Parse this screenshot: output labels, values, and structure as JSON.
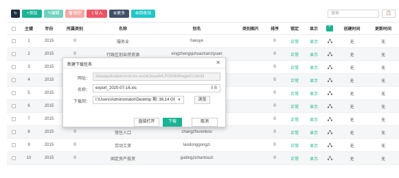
{
  "toolbar": {
    "refresh_icon": "↻",
    "add_label": "+添加",
    "edit_label": "✎编辑",
    "delete_label": "🗑删除",
    "import_label": "⇪导入",
    "more_label": "⚙更多",
    "recycle_label": "♻回收站",
    "search_placeholder": "搜索",
    "search_button_label": "📋"
  },
  "table": {
    "headers": {
      "id": "主键",
      "year": "年份",
      "category": "所属类别",
      "name": "名称",
      "alias": "别名",
      "image": "类别图片",
      "sort": "排序",
      "lock": "锁定",
      "show": "显示",
      "created": "创建时间",
      "updated": "更新时间"
    },
    "rows": [
      {
        "id": "1",
        "year": "2015",
        "category": "0",
        "name": "服务业",
        "alias": "fuwuye",
        "sort": "0",
        "lock": "正常",
        "show": "显示",
        "created": "无",
        "updated": "无"
      },
      {
        "id": "2",
        "year": "2015",
        "category": "0",
        "name": "行政区划自然资源",
        "alias": "xingzhengquhuaziranziyuan",
        "sort": "0",
        "lock": "正常",
        "show": "显示",
        "created": "无",
        "updated": "无"
      },
      {
        "id": "3",
        "year": "2015",
        "category": "",
        "name": "",
        "alias": "",
        "sort": "0",
        "lock": "正常",
        "show": "显示",
        "created": "无",
        "updated": "无"
      },
      {
        "id": "4",
        "year": "2015",
        "category": "",
        "name": "",
        "alias": "",
        "sort": "0",
        "lock": "正常",
        "show": "显示",
        "created": "无",
        "updated": "无"
      },
      {
        "id": "5",
        "year": "2015",
        "category": "",
        "name": "",
        "alias": "",
        "sort": "0",
        "lock": "正常",
        "show": "显示",
        "created": "无",
        "updated": "无"
      },
      {
        "id": "6",
        "year": "2015",
        "category": "",
        "name": "",
        "alias": "",
        "sort": "0",
        "lock": "正常",
        "show": "显示",
        "created": "无",
        "updated": "无"
      },
      {
        "id": "7",
        "year": "2015",
        "category": "",
        "name": "",
        "alias": "",
        "sort": "0",
        "lock": "正常",
        "show": "显示",
        "created": "无",
        "updated": "无"
      },
      {
        "id": "8",
        "year": "2015",
        "category": "0",
        "name": "常住人口",
        "alias": "changzhurenkou",
        "sort": "0",
        "lock": "正常",
        "show": "显示",
        "created": "无",
        "updated": "无"
      },
      {
        "id": "9",
        "year": "2015",
        "category": "0",
        "name": "劳动工资",
        "alias": "laodonggongzi",
        "sort": "0",
        "lock": "正常",
        "show": "显示",
        "created": "无",
        "updated": "无"
      },
      {
        "id": "10",
        "year": "2015",
        "category": "0",
        "name": "固定资产投资",
        "alias": "gudingzichantouzi",
        "sort": "0",
        "lock": "正常",
        "show": "显示",
        "created": "无",
        "updated": "无"
      }
    ]
  },
  "dialog": {
    "title": "新建下载任务",
    "close_icon": "✕",
    "url_label": "网址：",
    "url_value": "dataapplication/vnd.ms-excel;base64,PGh0bWwgeG1sbnM",
    "name_label": "名称：",
    "name_value": "export_2020-07-16.xls",
    "name_size": "0 B",
    "dir_label": "下载到：",
    "dir_value": "I:\\Users\\Administrator\\Desktop  剩: 36.14 GB",
    "dropdown_icon": "▼",
    "browse_label": "浏览",
    "open_label": "直接打开",
    "download_label": "下载",
    "cancel_label": "取消"
  }
}
